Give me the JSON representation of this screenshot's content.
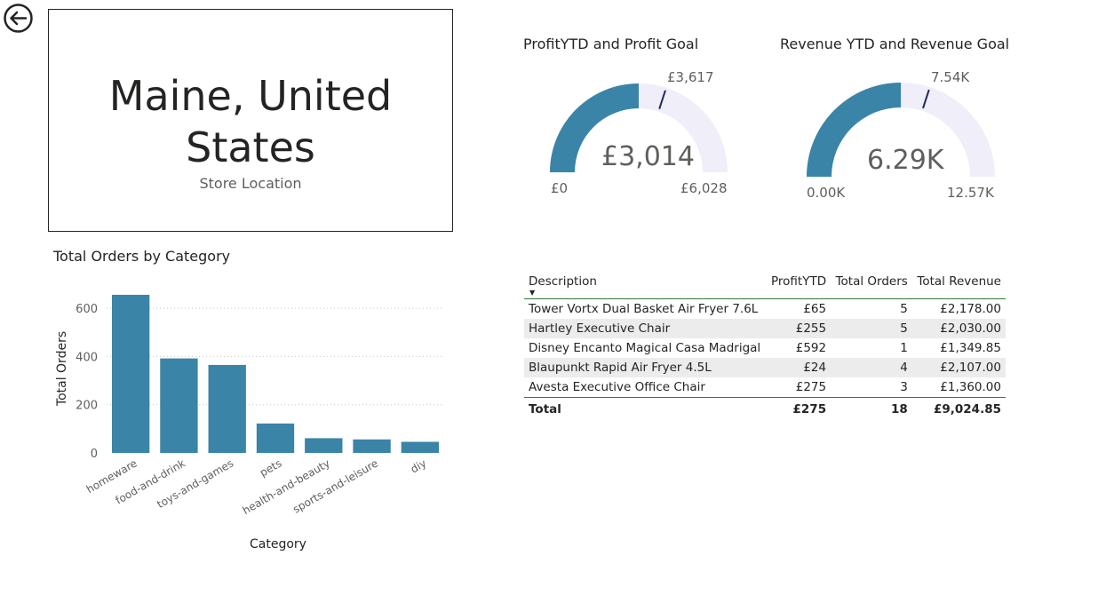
{
  "card": {
    "value_line1": "Maine, United",
    "value_line2": "States",
    "label": "Store Location"
  },
  "gauges": [
    {
      "title": "ProfitYTD and Profit Goal",
      "value_label": "£3,014",
      "min_label": "£0",
      "max_label": "£6,028",
      "target_label": "£3,617",
      "value": 3014,
      "min": 0,
      "max": 6028,
      "target": 3617
    },
    {
      "title": "Revenue YTD and Revenue Goal",
      "value_label": "6.29K",
      "min_label": "0.00K",
      "max_label": "12.57K",
      "target_label": "7.54K",
      "value": 6290,
      "min": 0,
      "max": 12570,
      "target": 7540
    }
  ],
  "colors": {
    "accent": "#3a84a8",
    "gauge_track": "#efeef9",
    "target_marker": "#1f2a55",
    "table_rule": "#2e7d32"
  },
  "chart_data": {
    "type": "bar",
    "title": "Total Orders by Category",
    "xlabel": "Category",
    "ylabel": "Total Orders",
    "categories": [
      "homeware",
      "food-and-drink",
      "toys-and-games",
      "pets",
      "health-and-beauty",
      "sports-and-leisure",
      "diy"
    ],
    "values": [
      656,
      392,
      365,
      122,
      61,
      56,
      46
    ],
    "yticks": [
      0,
      200,
      400,
      600
    ],
    "ylim": [
      0,
      700
    ],
    "grid": true
  },
  "table": {
    "columns": [
      "Description",
      "ProfitYTD",
      "Total Orders",
      "Total Revenue"
    ],
    "rows": [
      [
        "Tower Vortx Dual Basket Air Fryer 7.6L",
        "£65",
        "5",
        "£2,178.00"
      ],
      [
        "Hartley Executive Chair",
        "£255",
        "5",
        "£2,030.00"
      ],
      [
        "Disney Encanto Magical Casa Madrigal",
        "£592",
        "1",
        "£1,349.85"
      ],
      [
        "Blaupunkt Rapid Air Fryer 4.5L",
        "£24",
        "4",
        "£2,107.00"
      ],
      [
        "Avesta Executive Office Chair",
        "£275",
        "3",
        "£1,360.00"
      ]
    ],
    "total": [
      "Total",
      "£275",
      "18",
      "£9,024.85"
    ],
    "sort_indicator": "▼"
  },
  "nav": {
    "back_icon": "back-arrow-icon"
  }
}
